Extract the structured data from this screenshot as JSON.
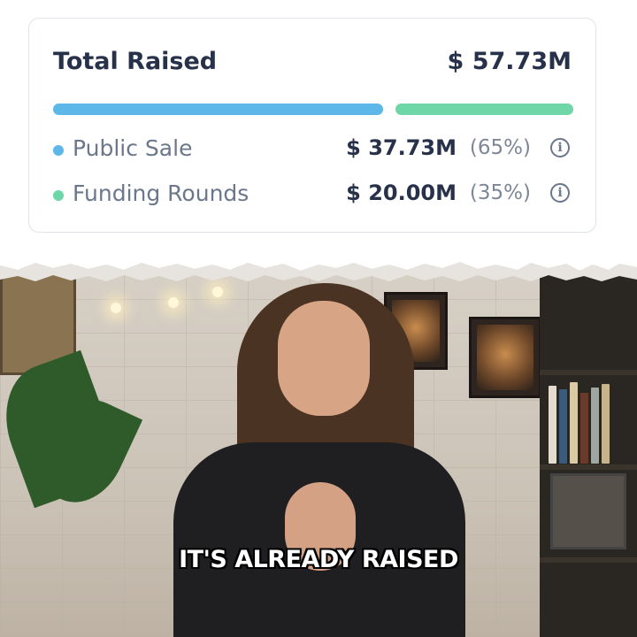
{
  "summary": {
    "title": "Total Raised",
    "total": "$ 57.73M"
  },
  "rows": [
    {
      "label": "Public Sale",
      "value": "$ 37.73M",
      "percent": "(65%)",
      "share": 0.65,
      "color": "#5db7e8",
      "info_icon": "info-icon"
    },
    {
      "label": "Funding Rounds",
      "value": "$ 20.00M",
      "percent": "(35%)",
      "share": 0.35,
      "color": "#6fd6a7",
      "info_icon": "info-icon"
    }
  ],
  "caption": "IT'S ALREADY RAISED",
  "colors": {
    "text_dark": "#27324a",
    "text_muted": "#6b778a",
    "public_sale": "#5db7e8",
    "funding_rounds": "#6fd6a7"
  }
}
